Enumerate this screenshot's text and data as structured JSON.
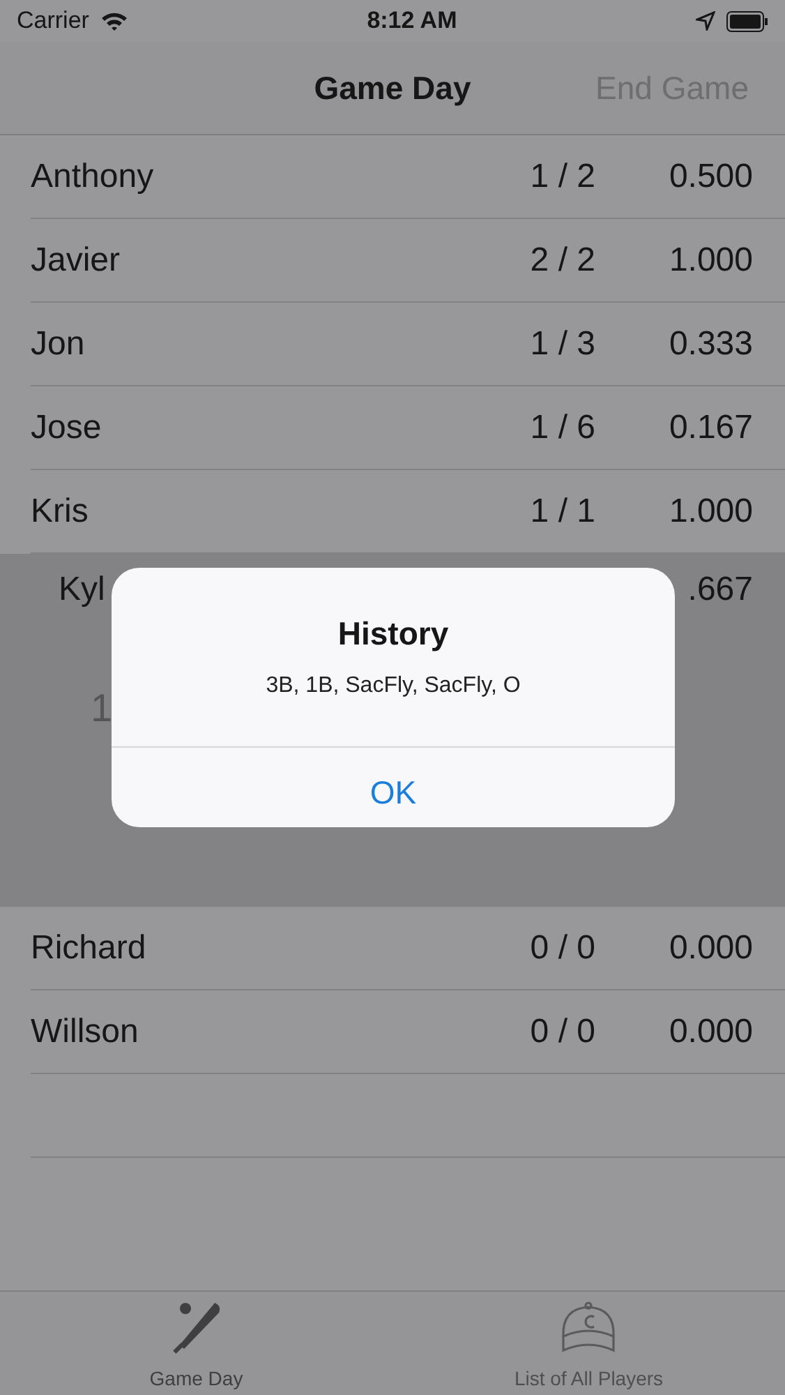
{
  "status_bar": {
    "carrier": "Carrier",
    "time": "8:12 AM"
  },
  "nav": {
    "title": "Game Day",
    "action": "End Game"
  },
  "players": [
    {
      "name": "Anthony",
      "hits": "1 / 2",
      "average": "0.500",
      "expanded": false
    },
    {
      "name": "Javier",
      "hits": "2 / 2",
      "average": "1.000",
      "expanded": false
    },
    {
      "name": "Jon",
      "hits": "1 / 3",
      "average": "0.333",
      "expanded": false
    },
    {
      "name": "Jose",
      "hits": "1 / 6",
      "average": "0.167",
      "expanded": false
    },
    {
      "name": "Kris",
      "hits": "1 / 1",
      "average": "1.000",
      "expanded": false
    },
    {
      "name": "Kyl",
      "average": ".667",
      "expanded": true,
      "actions": [
        "1"
      ]
    },
    {
      "name": "Richard",
      "hits": "0 / 0",
      "average": "0.000",
      "expanded": false
    },
    {
      "name": "Willson",
      "hits": "0 / 0",
      "average": "0.000",
      "expanded": false
    }
  ],
  "alert": {
    "title": "History",
    "message": "3B, 1B, SacFly, SacFly, O",
    "button": "OK"
  },
  "tabs": [
    {
      "label": "Game Day",
      "selected": true
    },
    {
      "label": "List of All Players",
      "selected": false
    }
  ]
}
